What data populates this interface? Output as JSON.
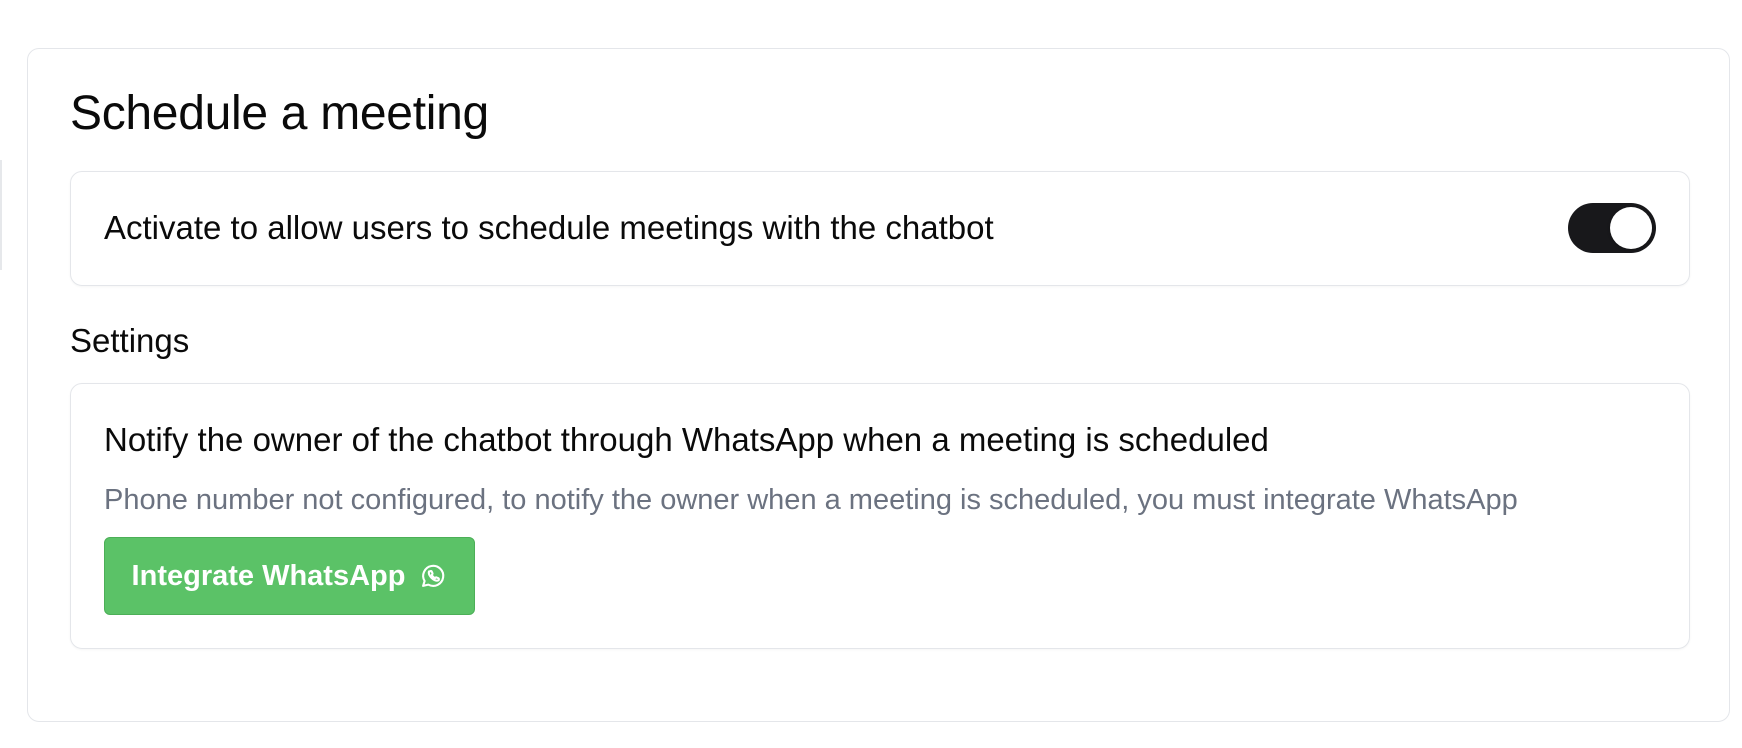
{
  "card": {
    "title": "Schedule a meeting"
  },
  "activation": {
    "label": "Activate to allow users to schedule meetings with the chatbot",
    "toggle_on": true
  },
  "settings": {
    "heading": "Settings",
    "notify": {
      "title": "Notify the owner of the chatbot through WhatsApp when a meeting is scheduled",
      "description": "Phone number not configured, to notify the owner when a meeting is scheduled, you must integrate WhatsApp",
      "button_label": "Integrate WhatsApp",
      "button_icon": "whatsapp-icon"
    }
  },
  "colors": {
    "toggle_on": "#18181b",
    "button_bg": "#5bc267",
    "muted_text": "#6b7280",
    "border": "#e4e6ea"
  }
}
